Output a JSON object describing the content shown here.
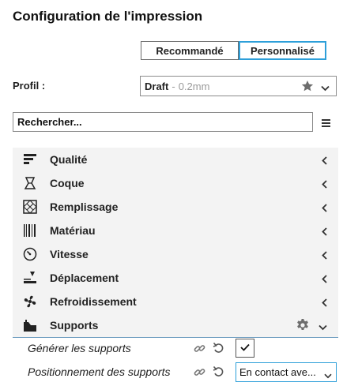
{
  "panel": {
    "title": "Configuration de l'impression"
  },
  "mode": {
    "recommended_label": "Recommandé",
    "custom_label": "Personnalisé",
    "selected": "custom"
  },
  "profile": {
    "label": "Profil :",
    "name": "Draft",
    "separator": "-",
    "layer": "0.2mm",
    "favorite_icon": "star-icon"
  },
  "search": {
    "text": "Rechercher..."
  },
  "categories": [
    {
      "label": "Qualité",
      "icon": "quality-icon",
      "expanded": false
    },
    {
      "label": "Coque",
      "icon": "shell-icon",
      "expanded": false
    },
    {
      "label": "Remplissage",
      "icon": "infill-icon",
      "expanded": false
    },
    {
      "label": "Matériau",
      "icon": "material-icon",
      "expanded": false
    },
    {
      "label": "Vitesse",
      "icon": "speed-icon",
      "expanded": false
    },
    {
      "label": "Déplacement",
      "icon": "travel-icon",
      "expanded": false
    },
    {
      "label": "Refroidissement",
      "icon": "cooling-icon",
      "expanded": false
    },
    {
      "label": "Supports",
      "icon": "support-icon",
      "expanded": true
    }
  ],
  "settings": [
    {
      "label": "Générer les supports",
      "type": "checkbox",
      "checked": true
    },
    {
      "label": "Positionnement des supports",
      "type": "dropdown",
      "value": "En contact ave..."
    }
  ],
  "colors": {
    "accent": "#2d9fd9",
    "category_bg": "#f3f3f3"
  }
}
